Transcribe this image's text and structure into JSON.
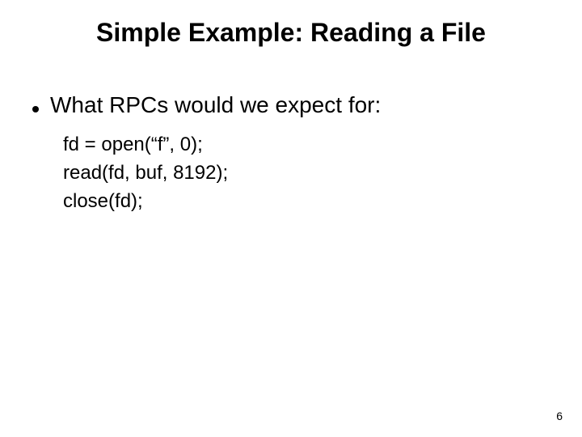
{
  "title": "Simple Example: Reading a File",
  "bullet": "What RPCs would we expect for:",
  "code": {
    "l1": "fd = open(“f”, 0);",
    "l2": "read(fd, buf, 8192);",
    "l3": "close(fd);"
  },
  "page_number": "6"
}
